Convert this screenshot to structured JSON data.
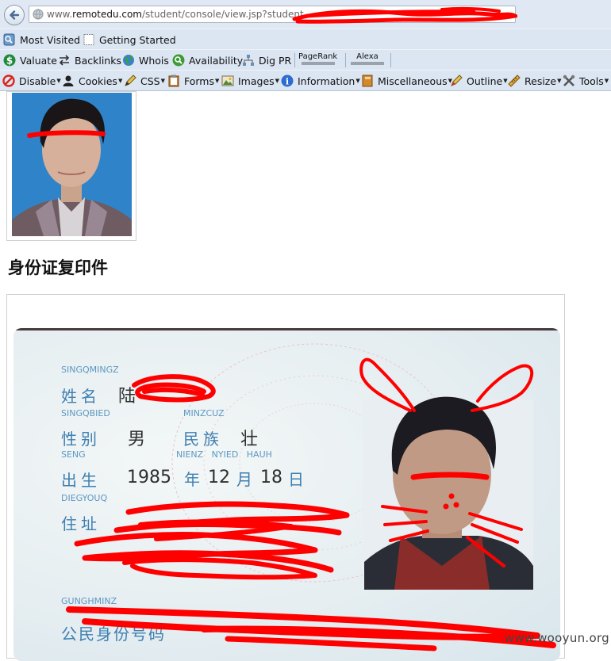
{
  "browser": {
    "url_prefix": "www.",
    "url_domain": "remotedu.com",
    "url_path": "/student/console/view.jsp?student",
    "bookmarks": [
      {
        "label": "Most Visited",
        "icon": "bookmarks-icon"
      },
      {
        "label": "Getting Started",
        "icon": "page-icon"
      }
    ],
    "seo_toolbar": [
      {
        "label": "Valuate",
        "icon": "dollar-icon"
      },
      {
        "label": "Backlinks",
        "icon": "arrows-icon"
      },
      {
        "label": "Whois",
        "icon": "globe-icon"
      },
      {
        "label": "Availability",
        "icon": "search-icon"
      },
      {
        "label": "Dig PR",
        "icon": "network-icon"
      }
    ],
    "meters": [
      "PageRank",
      "Alexa"
    ],
    "webdev_toolbar": [
      {
        "label": "Disable",
        "icon": "disable-icon"
      },
      {
        "label": "Cookies",
        "icon": "user-icon"
      },
      {
        "label": "CSS",
        "icon": "pencil-icon"
      },
      {
        "label": "Forms",
        "icon": "clipboard-icon"
      },
      {
        "label": "Images",
        "icon": "image-icon"
      },
      {
        "label": "Information",
        "icon": "info-icon"
      },
      {
        "label": "Miscellaneous",
        "icon": "book-icon"
      },
      {
        "label": "Outline",
        "icon": "pencil-icon"
      },
      {
        "label": "Resize",
        "icon": "ruler-icon"
      },
      {
        "label": "Tools",
        "icon": "tools-icon"
      }
    ]
  },
  "page": {
    "idcard_heading": "身份证复印件",
    "watermark": "www.wooyun.org"
  },
  "idcard": {
    "name_pinyin": "SINGQMINGZ",
    "name_label": "姓名",
    "name_value": "陆",
    "sex_pinyin": "SINGQBIED",
    "sex_label": "性别",
    "sex_value": "男",
    "ethnic_pinyin": "MINZCUZ",
    "ethnic_label": "民族",
    "ethnic_value": "壮",
    "birth_pinyin": "SENG",
    "birth_pinyin_2": "NIENZ   NYIED   HAUH",
    "birth_label": "出生",
    "birth_year": "1985",
    "year_char": "年",
    "birth_month": "12",
    "month_char": "月",
    "birth_day": "18",
    "day_char": "日",
    "address_pinyin": "DIEGYOUQ",
    "address_label": "住址",
    "idnum_pinyin": "GUNGHMINZ",
    "idnum_label": "公民身份号码"
  },
  "colors": {
    "redaction": "#ff0000",
    "toolbar_bg": "#dbe6f2",
    "card_label": "#3f7fb0"
  }
}
